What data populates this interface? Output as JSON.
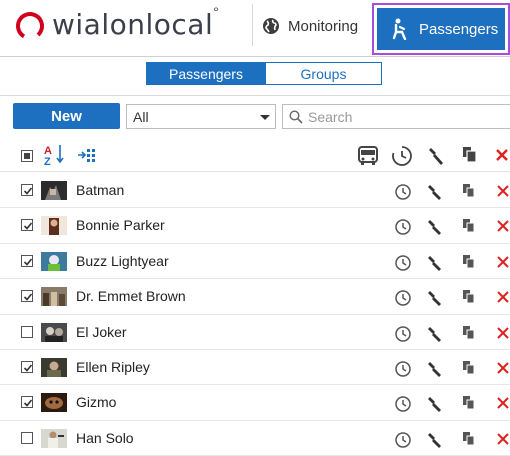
{
  "app": {
    "logo_text": "wialonlocal",
    "logo_superscript": "°",
    "brand_color": "#d0021b"
  },
  "nav": {
    "monitoring_label": "Monitoring",
    "passengers_label": "Passengers",
    "accent": "#1d6fc0",
    "highlight": "#a64ed9"
  },
  "tabs": {
    "passengers_label": "Passengers",
    "groups_label": "Groups"
  },
  "toolbar": {
    "new_label": "New",
    "filter_value": "All",
    "search_placeholder": "Search"
  },
  "list_header": {
    "icons": [
      "select-all-checkbox",
      "sort-az-icon",
      "groups-icon",
      "vehicle-icon",
      "history-icon",
      "properties-icon",
      "copy-icon",
      "delete-icon"
    ]
  },
  "passengers": [
    {
      "name": "Batman",
      "checked": true
    },
    {
      "name": "Bonnie Parker",
      "checked": true
    },
    {
      "name": "Buzz Lightyear",
      "checked": true
    },
    {
      "name": "Dr. Emmet Brown",
      "checked": true
    },
    {
      "name": "El Joker",
      "checked": false
    },
    {
      "name": "Ellen Ripley",
      "checked": true
    },
    {
      "name": "Gizmo",
      "checked": true
    },
    {
      "name": "Han Solo",
      "checked": false
    }
  ],
  "row_icons": [
    "history-icon",
    "properties-icon",
    "copy-icon",
    "delete-icon"
  ]
}
